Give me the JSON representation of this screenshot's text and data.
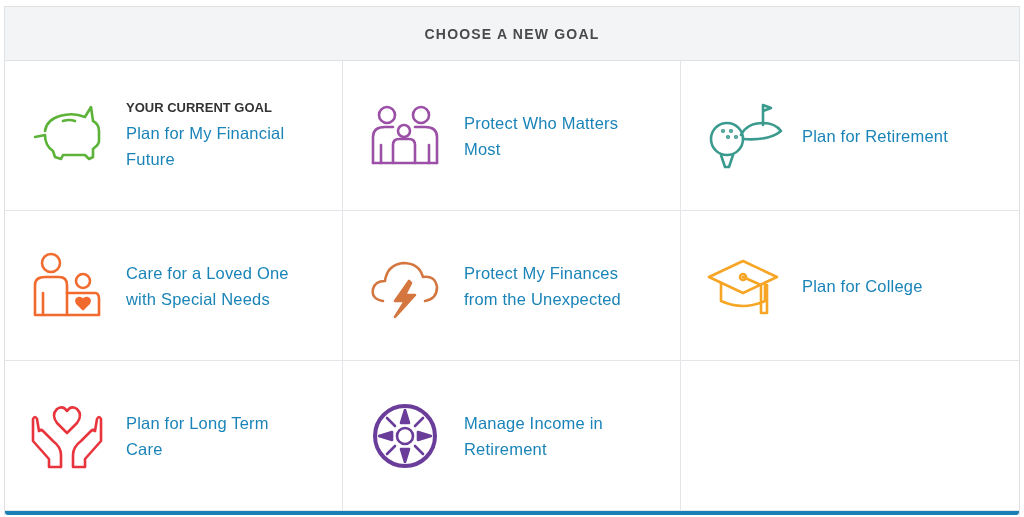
{
  "header": {
    "title": "CHOOSE A NEW GOAL"
  },
  "goals": [
    {
      "kind": "piggy",
      "color": "#5db33a",
      "tag": "YOUR CURRENT GOAL",
      "title_lines": [
        "Plan for My Financial",
        "Future"
      ]
    },
    {
      "kind": "family",
      "color": "#9b4fa6",
      "title_lines": [
        "Protect Who Matters",
        "Most"
      ]
    },
    {
      "kind": "golf",
      "color": "#3a9a8e",
      "title_lines": [
        "Plan for Retirement"
      ]
    },
    {
      "kind": "parent-child",
      "color": "#f26a2e",
      "title_lines": [
        "Care for a Loved One",
        "with Special Needs"
      ]
    },
    {
      "kind": "storm",
      "color": "#d4763f",
      "title_lines": [
        "Protect My Finances",
        "from the Unexpected"
      ]
    },
    {
      "kind": "cap",
      "color": "#f6a524",
      "title_lines": [
        "Plan for College"
      ]
    },
    {
      "kind": "hands",
      "color": "#e8343c",
      "title_lines": [
        "Plan for Long Term",
        "Care"
      ]
    },
    {
      "kind": "compass",
      "color": "#6a3d9a",
      "title_lines": [
        "Manage Income in",
        "Retirement"
      ]
    }
  ]
}
